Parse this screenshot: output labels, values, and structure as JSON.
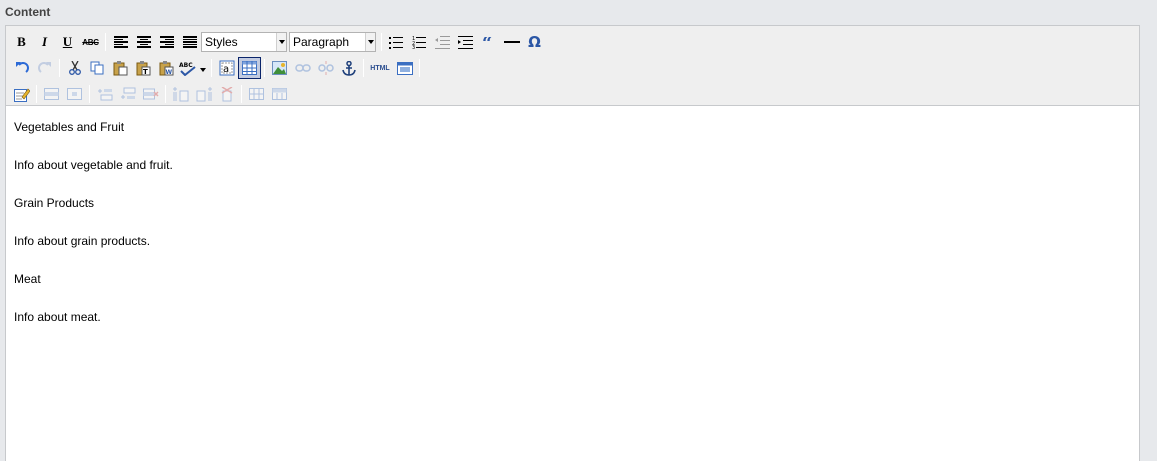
{
  "field": {
    "label": "Content"
  },
  "toolbar": {
    "bold": "B",
    "italic": "I",
    "underline": "U",
    "strike": "ABC",
    "styles_select": "Styles",
    "format_select": "Paragraph",
    "html_button": "HTML",
    "omega": "Ω",
    "spell_label": "ABC"
  },
  "content": {
    "paragraphs": [
      "Vegetables and Fruit",
      "Info about vegetable and fruit.",
      "Grain Products",
      "Info about grain products.",
      "Meat",
      "Info about meat."
    ]
  }
}
